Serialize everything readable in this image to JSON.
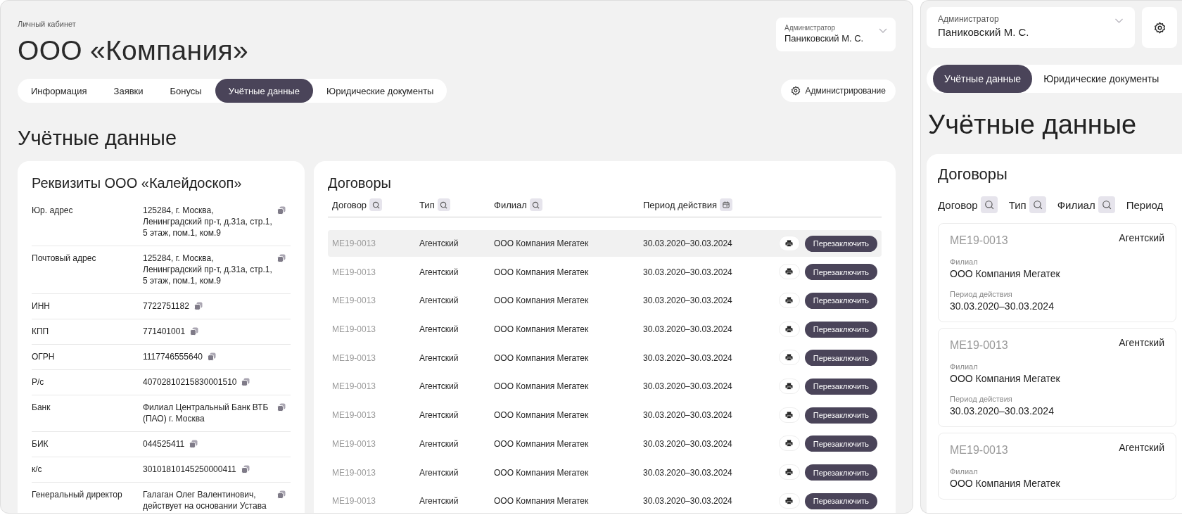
{
  "desktop": {
    "breadcrumb": "Личный кабинет",
    "title": "ООО «Компания»",
    "user": {
      "role": "Администратор",
      "name": "Паниковский М. С."
    },
    "tabs": [
      {
        "label": "Информация",
        "selected": false
      },
      {
        "label": "Заявки",
        "selected": false
      },
      {
        "label": "Бонусы",
        "selected": false
      },
      {
        "label": "Учётные данные",
        "selected": true
      },
      {
        "label": "Юридические документы",
        "selected": false
      }
    ],
    "admin_button": "Администрирование",
    "section_title": "Учётные данные",
    "requisites": {
      "title": "Реквизиты ООО «Калейдоскоп»",
      "rows": [
        {
          "label": "Юр. адрес",
          "value": "125284, г. Москва, Ленинградский пр-т, д.31а, стр.1, 5 этаж, пом.1, ком.9"
        },
        {
          "label": "Почтовый адрес",
          "value": "125284, г. Москва, Ленинградский пр-т, д.31а, стр.1, 5 этаж, пом.1, ком.9"
        },
        {
          "label": "ИНН",
          "value": "7722751182"
        },
        {
          "label": "КПП",
          "value": "771401001"
        },
        {
          "label": "ОГРН",
          "value": "1117746555640"
        },
        {
          "label": "Р/с",
          "value": "40702810215830001510"
        },
        {
          "label": "Банк",
          "value": "Филиал Центральный Банк ВТБ (ПАО) г. Москва"
        },
        {
          "label": "БИК",
          "value": "044525411"
        },
        {
          "label": "к/с",
          "value": "30101810145250000411"
        },
        {
          "label": "Генеральный директор",
          "value": "Галаган Олег Валентинович, действует на основании Устава"
        }
      ]
    },
    "contracts": {
      "title": "Договоры",
      "columns": [
        {
          "label": "Договор",
          "kind": "search"
        },
        {
          "label": "Тип",
          "kind": "search"
        },
        {
          "label": "Филиал",
          "kind": "search"
        },
        {
          "label": "Период действия",
          "kind": "date"
        }
      ],
      "rows": [
        {
          "contract": "ME19-0013",
          "type": "Агентский",
          "branch": "ООО Компания Мегатек",
          "period": "30.03.2020–30.03.2024",
          "action": "Перезаключить",
          "selected": true
        },
        {
          "contract": "ME19-0013",
          "type": "Агентский",
          "branch": "ООО Компания Мегатек",
          "period": "30.03.2020–30.03.2024",
          "action": "Перезаключить",
          "selected": false
        },
        {
          "contract": "ME19-0013",
          "type": "Агентский",
          "branch": "ООО Компания Мегатек",
          "period": "30.03.2020–30.03.2024",
          "action": "Перезаключить",
          "selected": false
        },
        {
          "contract": "ME19-0013",
          "type": "Агентский",
          "branch": "ООО Компания Мегатек",
          "period": "30.03.2020–30.03.2024",
          "action": "Перезаключить",
          "selected": false
        },
        {
          "contract": "ME19-0013",
          "type": "Агентский",
          "branch": "ООО Компания Мегатек",
          "period": "30.03.2020–30.03.2024",
          "action": "Перезаключить",
          "selected": false
        },
        {
          "contract": "ME19-0013",
          "type": "Агентский",
          "branch": "ООО Компания Мегатек",
          "period": "30.03.2020–30.03.2024",
          "action": "Перезаключить",
          "selected": false
        },
        {
          "contract": "ME19-0013",
          "type": "Агентский",
          "branch": "ООО Компания Мегатек",
          "period": "30.03.2020–30.03.2024",
          "action": "Перезаключить",
          "selected": false
        },
        {
          "contract": "ME19-0013",
          "type": "Агентский",
          "branch": "ООО Компания Мегатек",
          "period": "30.03.2020–30.03.2024",
          "action": "Перезаключить",
          "selected": false
        },
        {
          "contract": "ME19-0013",
          "type": "Агентский",
          "branch": "ООО Компания Мегатек",
          "period": "30.03.2020–30.03.2024",
          "action": "Перезаключить",
          "selected": false
        },
        {
          "contract": "ME19-0013",
          "type": "Агентский",
          "branch": "ООО Компания Мегатек",
          "period": "30.03.2020–30.03.2024",
          "action": "Перезаключить",
          "selected": false
        }
      ]
    }
  },
  "mobile": {
    "user": {
      "role": "Администратор",
      "name": "Паниковский М. С."
    },
    "tabs": [
      {
        "label": "Учётные данные",
        "selected": true
      },
      {
        "label": "Юридические документы",
        "selected": false
      }
    ],
    "section_title": "Учётные данные",
    "contracts": {
      "title": "Договоры",
      "columns": [
        {
          "label": "Договор",
          "kind": "search"
        },
        {
          "label": "Тип",
          "kind": "search"
        },
        {
          "label": "Филиал",
          "kind": "search"
        },
        {
          "label": "Период",
          "kind": "plain"
        }
      ],
      "cards": [
        {
          "contract": "ME19-0013",
          "type": "Агентский",
          "branch_label": "Филиал",
          "branch": "ООО Компания Мегатек",
          "period_label": "Период действия",
          "period": "30.03.2020–30.03.2024"
        },
        {
          "contract": "ME19-0013",
          "type": "Агентский",
          "branch_label": "Филиал",
          "branch": "ООО Компания Мегатек",
          "period_label": "Период действия",
          "period": "30.03.2020–30.03.2024"
        },
        {
          "contract": "ME19-0013",
          "type": "Агентский",
          "branch_label": "Филиал",
          "branch": "ООО Компания Мегатек"
        }
      ]
    }
  }
}
